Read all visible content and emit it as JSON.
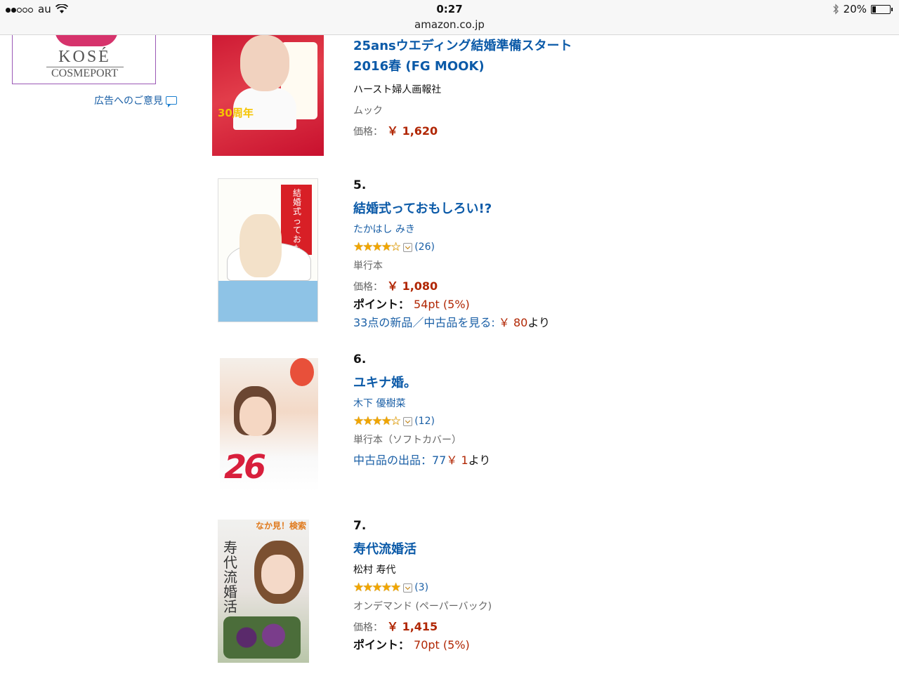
{
  "status_bar": {
    "carrier": "au",
    "time": "0:27",
    "url": "amazon.co.jp",
    "battery": "20%",
    "battery_level": 0.2
  },
  "sidebar_ad": {
    "brand": "KOSÉ",
    "subbrand": "COSMEPORT",
    "feedback_label": "広告へのご意見"
  },
  "products": [
    {
      "title_line1": "25ansウエディング結婚準備スタート",
      "title_line2": "2016春 (FG MOOK)",
      "author": "ハースト婦人画報社",
      "format": "ムック",
      "price_label": "価格：",
      "price": "￥ 1,620",
      "cover_badge": "30周年"
    },
    {
      "rank": "5.",
      "title": "結婚式っておもしろい!?",
      "author": "たかはし みき",
      "stars": "★★★★☆",
      "rating_count": "(26)",
      "format": "単行本",
      "price_label": "価格：",
      "price": "￥ 1,080",
      "points_label": "ポイント：",
      "points": "54pt (5%)",
      "offers_link": "33点の新品／中古品を見る:",
      "offers_price": "￥ 80",
      "offers_suffix": "より",
      "cover_title": "結婚式っておもしろい!?"
    },
    {
      "rank": "6.",
      "title": "ユキナ婚。",
      "author": "木下 優樹菜",
      "stars": "★★★★☆",
      "rating_count": "(12)",
      "format": "単行本（ソフトカバー）",
      "offers_link": "中古品の出品：77",
      "offers_price": "￥ 1",
      "offers_suffix": "より",
      "cover_num": "26"
    },
    {
      "rank": "7.",
      "title": "寿代流婚活",
      "author": "松村 寿代",
      "stars": "★★★★★",
      "rating_count": "(3)",
      "format": "オンデマンド (ペーパーバック)",
      "price_label": "価格：",
      "price": "￥ 1,415",
      "points_label": "ポイント：",
      "points": "70pt (5%)",
      "cover_badge": "なか見！検索",
      "cover_title": "寿代流婚活"
    }
  ]
}
